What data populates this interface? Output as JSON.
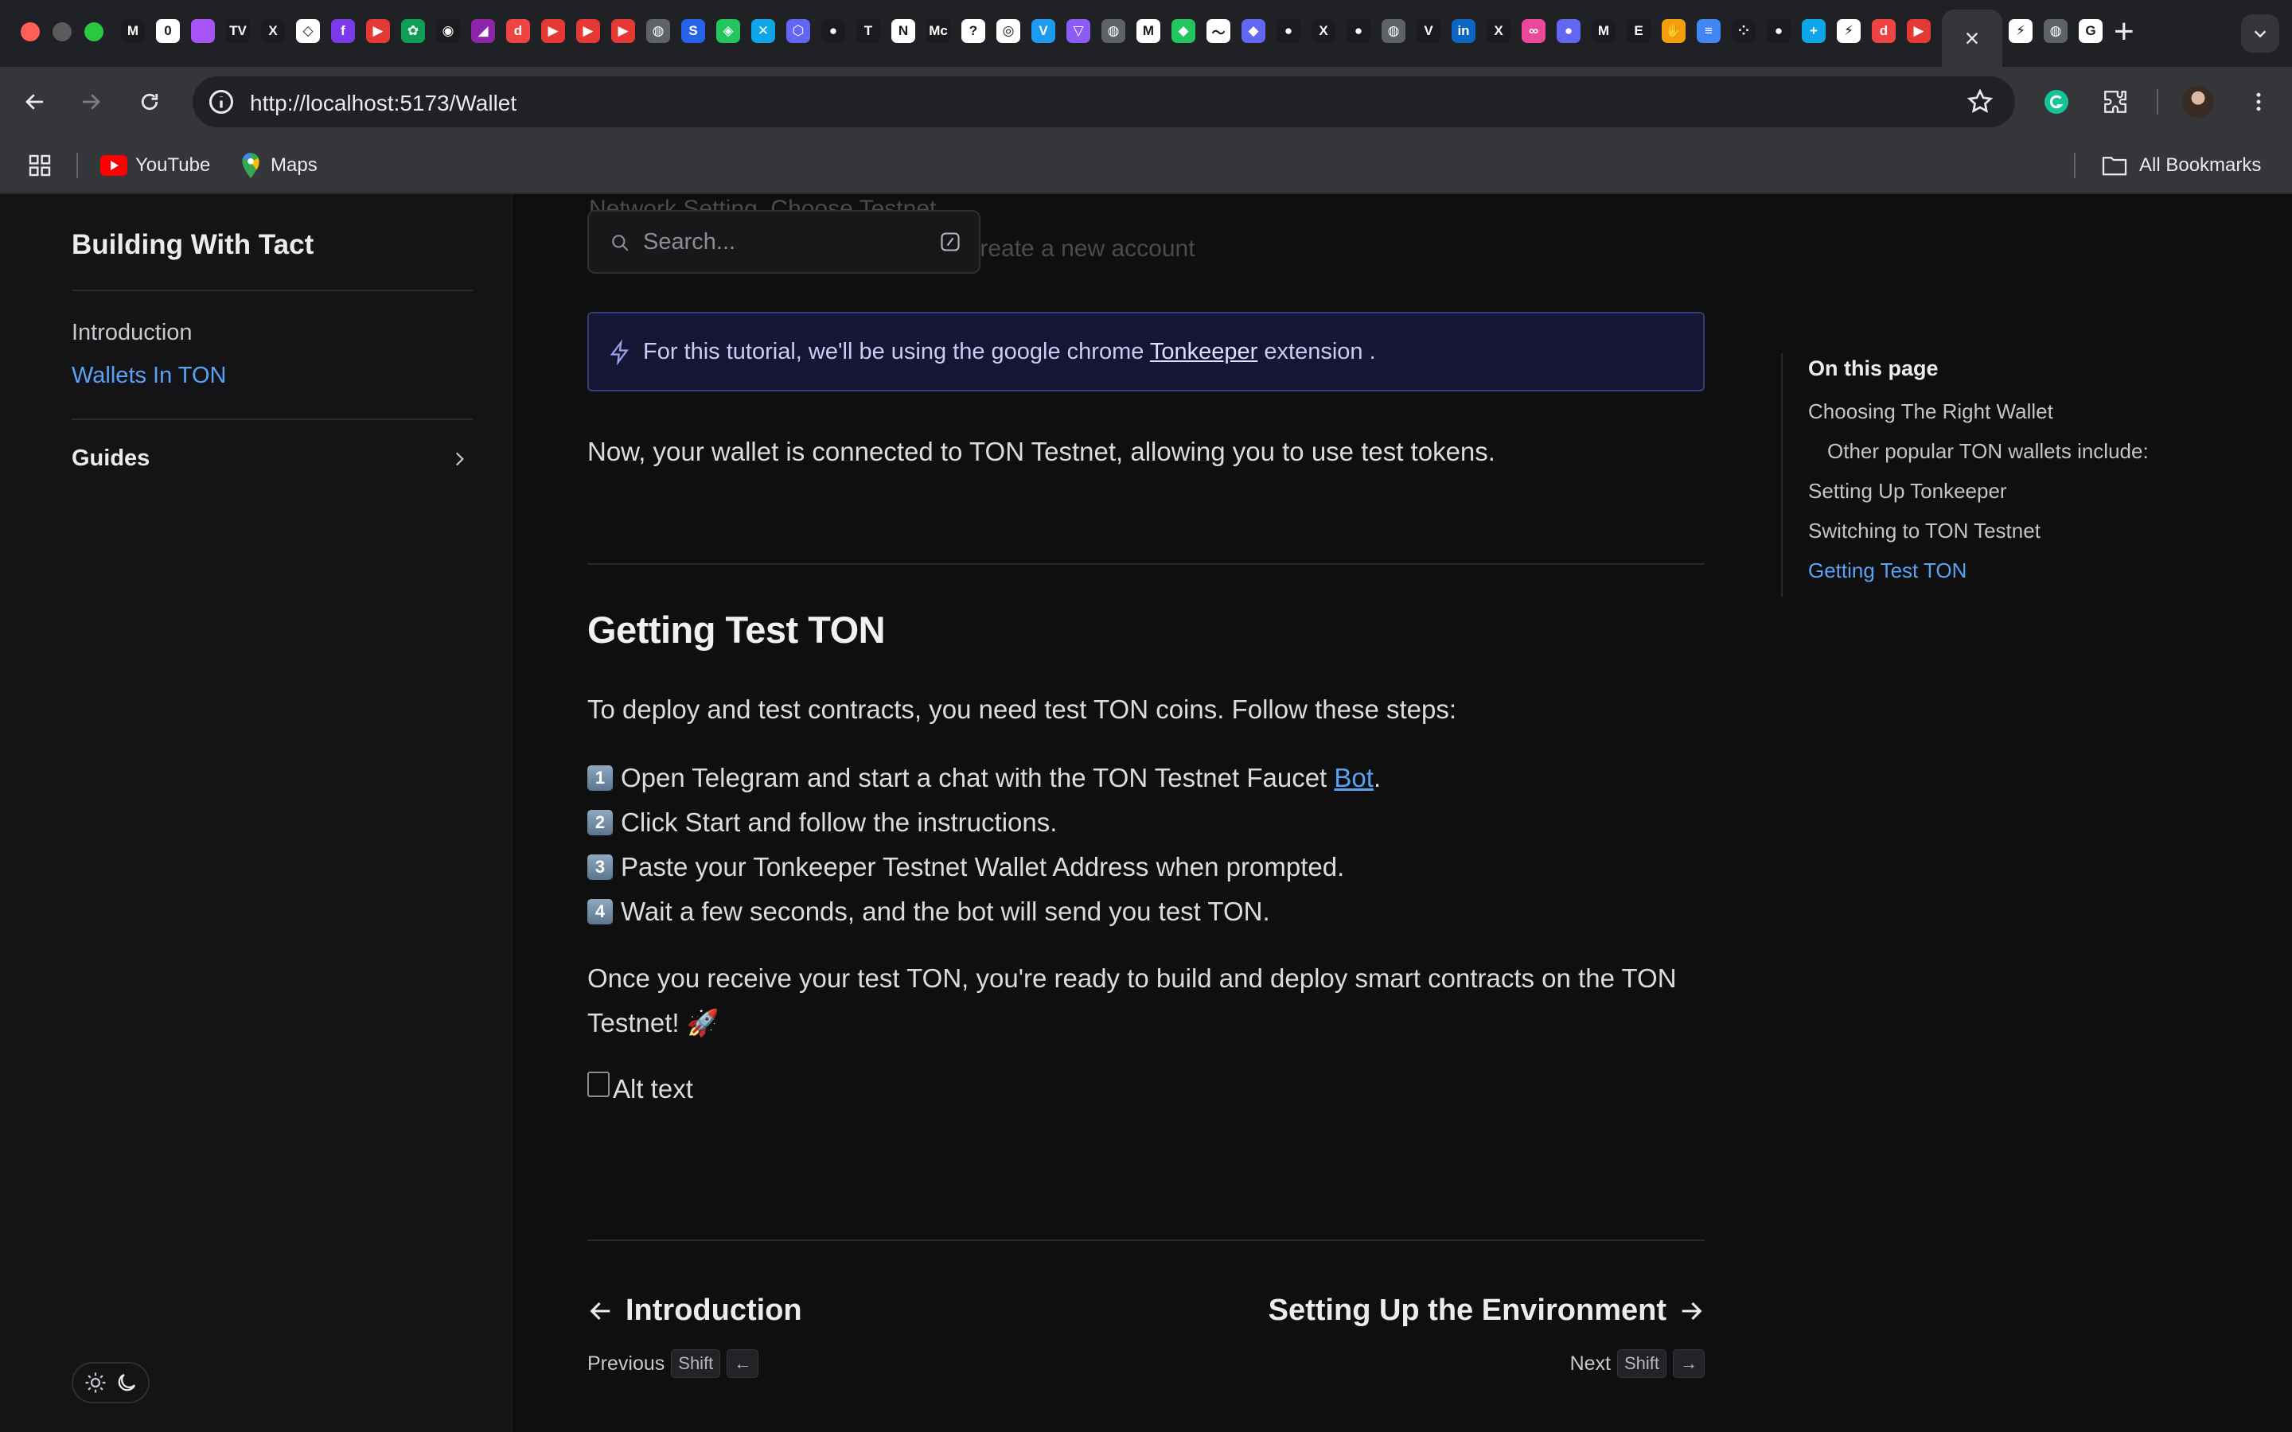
{
  "browser": {
    "url": "http://localhost:5173/Wallet",
    "bookmarks": [
      {
        "label": "YouTube",
        "icon": "youtube-icon"
      },
      {
        "label": "Maps",
        "icon": "maps-pin-icon"
      }
    ],
    "all_bookmarks": "All Bookmarks",
    "tab_favicons": [
      {
        "icon": "m-icon",
        "color": "#1b1b1f",
        "glyph": "M"
      },
      {
        "icon": "notion-square-icon",
        "color": "#ffffff",
        "glyph": "0"
      },
      {
        "icon": "gradient-icon",
        "color": "#a855f7",
        "glyph": ""
      },
      {
        "icon": "tradingview-icon",
        "color": "#1b1b1f",
        "glyph": "TV"
      },
      {
        "icon": "x-icon",
        "color": "#1b1b1f",
        "glyph": "X"
      },
      {
        "icon": "diamond-icon",
        "color": "#ffffff",
        "glyph": "◇"
      },
      {
        "icon": "f-icon",
        "color": "#7c3aed",
        "glyph": "f"
      },
      {
        "icon": "youtube-icon",
        "color": "#e53935",
        "glyph": "▶"
      },
      {
        "icon": "plant-icon",
        "color": "#0f9d58",
        "glyph": "✿"
      },
      {
        "icon": "robot-icon",
        "color": "#1b1b1f",
        "glyph": "◉"
      },
      {
        "icon": "prism-icon",
        "color": "#8e24aa",
        "glyph": "◢"
      },
      {
        "icon": "d-icon",
        "color": "#ef4444",
        "glyph": "d"
      },
      {
        "icon": "youtube-icon",
        "color": "#e53935",
        "glyph": "▶"
      },
      {
        "icon": "youtube-icon",
        "color": "#e53935",
        "glyph": "▶"
      },
      {
        "icon": "youtube-icon",
        "color": "#e53935",
        "glyph": "▶"
      },
      {
        "icon": "globe-icon",
        "color": "#5f6368",
        "glyph": "◍"
      },
      {
        "icon": "s-icon",
        "color": "#2563eb",
        "glyph": "S"
      },
      {
        "icon": "puzzle-icon",
        "color": "#22c55e",
        "glyph": "◈"
      },
      {
        "icon": "x-teal-icon",
        "color": "#0ea5e9",
        "glyph": "✕"
      },
      {
        "icon": "hexagon-icon",
        "color": "#6366f1",
        "glyph": "⬡"
      },
      {
        "icon": "github-icon",
        "color": "#1b1b1f",
        "glyph": "●"
      },
      {
        "icon": "t-icon",
        "color": "#1b1b1f",
        "glyph": "T"
      },
      {
        "icon": "notion-icon",
        "color": "#ffffff",
        "glyph": "N"
      },
      {
        "icon": "mc-icon",
        "color": "#1b1b1f",
        "glyph": "Mc"
      },
      {
        "icon": "question-icon",
        "color": "#ffffff",
        "glyph": "?"
      },
      {
        "icon": "openai-icon",
        "color": "#ffffff",
        "glyph": "◎"
      },
      {
        "icon": "v-shield-icon",
        "color": "#1d9bf0",
        "glyph": "V"
      },
      {
        "icon": "triangle-icon",
        "color": "#8b5cf6",
        "glyph": "▽"
      },
      {
        "icon": "globe-icon",
        "color": "#5f6368",
        "glyph": "◍"
      },
      {
        "icon": "gmail-icon",
        "color": "#ffffff",
        "glyph": "M"
      },
      {
        "icon": "alien-icon",
        "color": "#22c55e",
        "glyph": "◆"
      },
      {
        "icon": "wave-icon",
        "color": "#ffffff",
        "glyph": "〜"
      },
      {
        "icon": "ethereum-icon",
        "color": "#6366f1",
        "glyph": "◆"
      },
      {
        "icon": "github-icon",
        "color": "#1b1b1f",
        "glyph": "●"
      },
      {
        "icon": "x-icon",
        "color": "#1b1b1f",
        "glyph": "X"
      },
      {
        "icon": "github-icon",
        "color": "#1b1b1f",
        "glyph": "●"
      },
      {
        "icon": "globe-icon",
        "color": "#5f6368",
        "glyph": "◍"
      },
      {
        "icon": "v-icon",
        "color": "#1b1b1f",
        "glyph": "V"
      },
      {
        "icon": "linkedin-icon",
        "color": "#0a66c2",
        "glyph": "in"
      },
      {
        "icon": "x-icon",
        "color": "#1b1b1f",
        "glyph": "X"
      },
      {
        "icon": "link-icon",
        "color": "#ec4899",
        "glyph": "∞"
      },
      {
        "icon": "orb-icon",
        "color": "#6366f1",
        "glyph": "●"
      },
      {
        "icon": "m-outline-icon",
        "color": "#1b1b1f",
        "glyph": "M"
      },
      {
        "icon": "e-icon",
        "color": "#1b1b1f",
        "glyph": "E"
      },
      {
        "icon": "hand-icon",
        "color": "#f59e0b",
        "glyph": "✋"
      },
      {
        "icon": "docs-icon",
        "color": "#4285f4",
        "glyph": "≡"
      },
      {
        "icon": "dots-icon",
        "color": "#1b1b1f",
        "glyph": "⁘"
      },
      {
        "icon": "github-icon",
        "color": "#1b1b1f",
        "glyph": "●"
      },
      {
        "icon": "plus-tool-icon",
        "color": "#0ea5e9",
        "glyph": "+"
      },
      {
        "icon": "slash-icon",
        "color": "#ffffff",
        "glyph": "⚡"
      },
      {
        "icon": "d-icon",
        "color": "#ef4444",
        "glyph": "d"
      },
      {
        "icon": "youtube-icon",
        "color": "#e53935",
        "glyph": "▶"
      },
      {
        "icon": "bolt-icon",
        "color": "#a855f7",
        "glyph": "⚡"
      }
    ],
    "after_tab_favicons": [
      {
        "icon": "slash-icon",
        "color": "#ffffff",
        "glyph": "⚡"
      },
      {
        "icon": "globe-icon",
        "color": "#5f6368",
        "glyph": "◍"
      },
      {
        "icon": "google-icon",
        "color": "#ffffff",
        "glyph": "G"
      }
    ]
  },
  "sidebar": {
    "site_title": "Building With Tact",
    "links": [
      {
        "label": "Introduction",
        "active": false
      },
      {
        "label": "Wallets In TON",
        "active": true
      }
    ],
    "guides_label": "Guides"
  },
  "search": {
    "placeholder": "Search..."
  },
  "ghost_lines": [
    "Network Setting. Choose Testnet",
    "Switch from Mainnet to Testnet and create a new account"
  ],
  "callout": {
    "before": "For this tutorial, we'll be using the google chrome ",
    "link": "Tonkeeper",
    "after": " extension ."
  },
  "content": {
    "connected_text": "Now, your wallet is connected to TON Testnet, allowing you to use test tokens.",
    "heading": "Getting Test TON",
    "intro": "To deploy and test contracts, you need test TON coins. Follow these steps:",
    "steps": [
      {
        "num": "1",
        "text": "Open Telegram and start a chat with the TON Testnet Faucet ",
        "link": "Bot",
        "after": "."
      },
      {
        "num": "2",
        "text": "Click Start and follow the instructions.",
        "link": "",
        "after": ""
      },
      {
        "num": "3",
        "text": "Paste your Tonkeeper Testnet Wallet Address when prompted.",
        "link": "",
        "after": ""
      },
      {
        "num": "4",
        "text": "Wait a few seconds, and the bot will send you test TON.",
        "link": "",
        "after": ""
      }
    ],
    "outro_line1": "Once you receive your test TON, you're ready to build and deploy smart contracts on the TON",
    "outro_line2": "Testnet! 🚀",
    "image_alt": "Alt text"
  },
  "pager": {
    "prev_title": "Introduction",
    "prev_label": "Previous",
    "next_title": "Setting Up the Environment",
    "next_label": "Next",
    "shift": "Shift"
  },
  "toc": {
    "title": "On this page",
    "items": [
      {
        "label": "Choosing The Right Wallet",
        "sub": false,
        "active": false
      },
      {
        "label": "Other popular TON wallets include:",
        "sub": true,
        "active": false
      },
      {
        "label": "Setting Up Tonkeeper",
        "sub": false,
        "active": false
      },
      {
        "label": "Switching to TON Testnet",
        "sub": false,
        "active": false
      },
      {
        "label": "Getting Test TON",
        "sub": false,
        "active": true
      }
    ]
  },
  "colors": {
    "accent": "#5aa2f5",
    "background": "#0f0f10",
    "sidebar": "#141416",
    "callout_bg": "#151633"
  }
}
